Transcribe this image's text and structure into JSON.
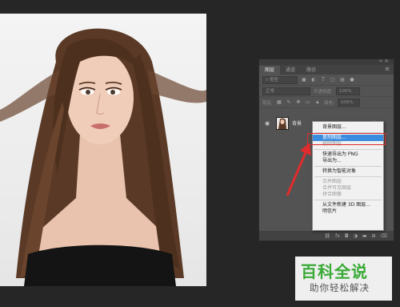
{
  "panel": {
    "tabs": [
      "图层",
      "通道",
      "路径"
    ],
    "filter_label": "类型",
    "blend_mode": "正常",
    "opacity_label": "不透明度:",
    "opacity_value": "100%",
    "lock_label": "锁定:",
    "fill_label": "填充:",
    "fill_value": "100%",
    "layer_name": "背景",
    "bottom_icons": [
      "link-icon",
      "fx-icon",
      "mask-icon",
      "adjustment-icon",
      "folder-icon",
      "new-layer-icon",
      "trash-icon"
    ]
  },
  "context_menu": {
    "items": [
      {
        "label": "背景图层...",
        "state": "normal"
      },
      {
        "sep": true
      },
      {
        "label": "复制图层...",
        "state": "highlighted"
      },
      {
        "label": "删除图层",
        "state": "disabled"
      },
      {
        "sep": true
      },
      {
        "label": "快速导出为 PNG",
        "state": "normal"
      },
      {
        "label": "导出为...",
        "state": "normal"
      },
      {
        "sep": true
      },
      {
        "label": "转换为智能对象",
        "state": "normal"
      },
      {
        "sep": true
      },
      {
        "label": "合并图层",
        "state": "disabled"
      },
      {
        "label": "合并可见图层",
        "state": "disabled"
      },
      {
        "label": "拼合图像",
        "state": "disabled"
      },
      {
        "sep": true
      },
      {
        "label": "从文件新建 3D 图层...",
        "state": "normal"
      },
      {
        "label": "明信片",
        "state": "normal"
      }
    ]
  },
  "watermark": {
    "line1": "百科全说",
    "line2": "助你轻松解决"
  },
  "colors": {
    "highlight": "#3a8dde",
    "annotation": "#e02c2c",
    "watermark_green": "#3aaa36"
  }
}
